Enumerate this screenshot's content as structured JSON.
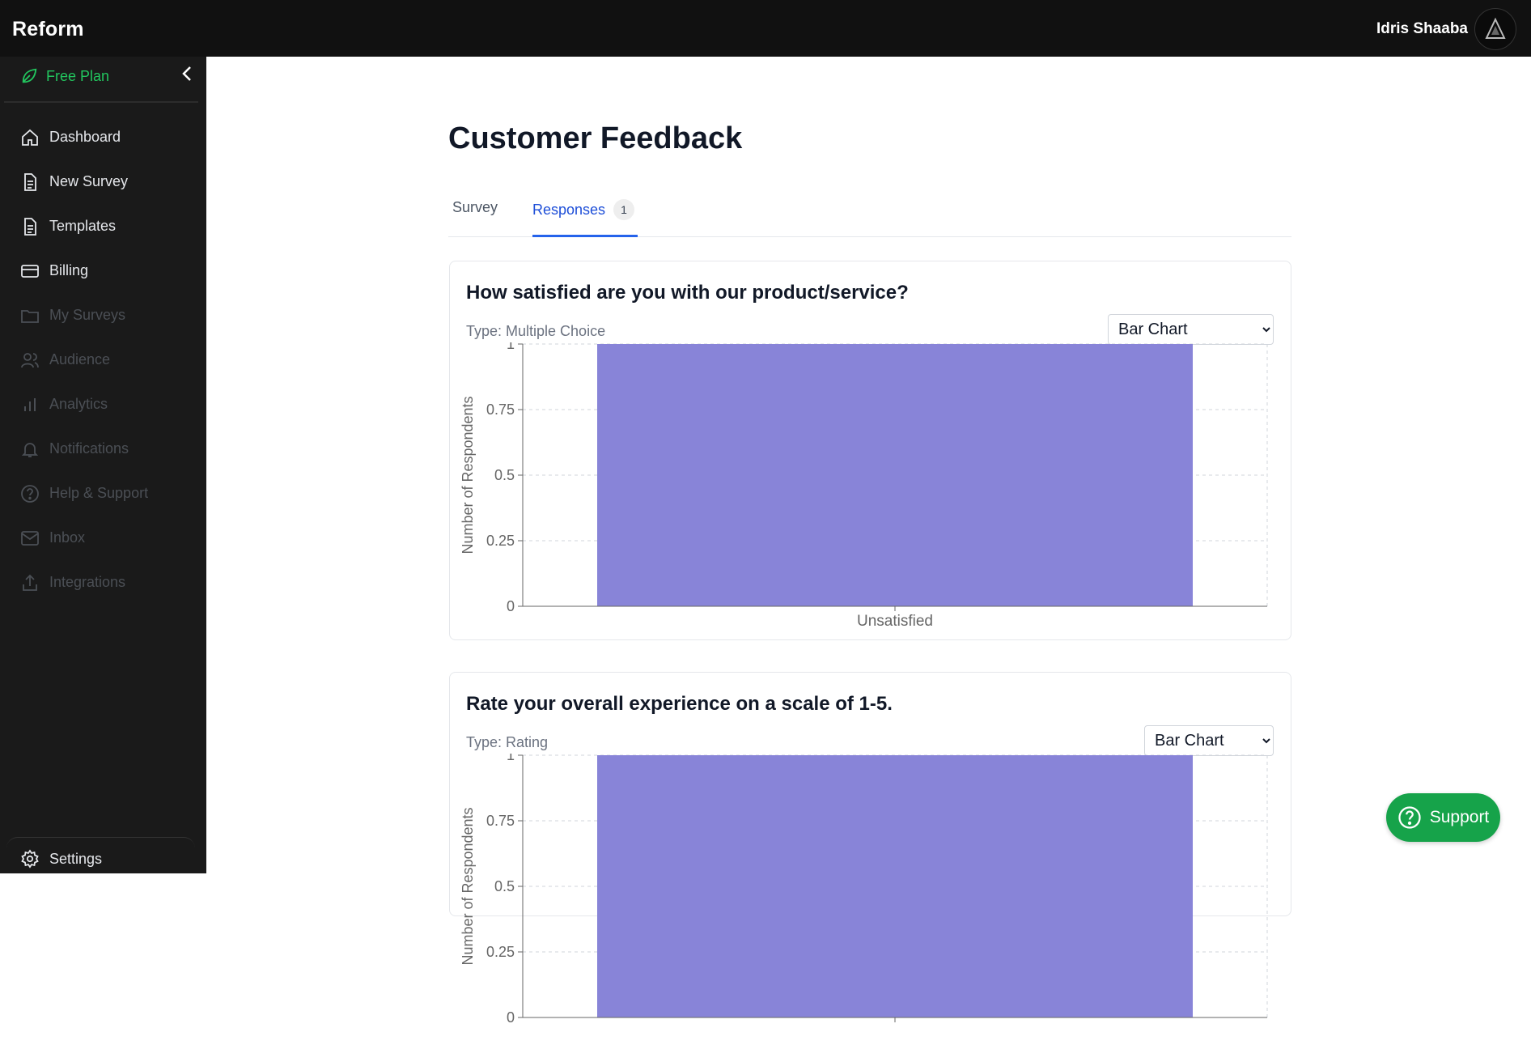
{
  "app": {
    "brand": "Reform"
  },
  "user": {
    "name": "Idris Shaaba",
    "avatar_icon": "user-avatar-icon"
  },
  "sidebar": {
    "plan_label": "Free Plan",
    "plan_color": "#22c55e",
    "items": [
      {
        "label": "Dashboard",
        "icon": "home-icon",
        "enabled": true
      },
      {
        "label": "New Survey",
        "icon": "document-icon",
        "enabled": true
      },
      {
        "label": "Templates",
        "icon": "document-icon",
        "enabled": true
      },
      {
        "label": "Billing",
        "icon": "credit-card-icon",
        "enabled": true
      },
      {
        "label": "My Surveys",
        "icon": "folder-icon",
        "enabled": false
      },
      {
        "label": "Audience",
        "icon": "users-icon",
        "enabled": false
      },
      {
        "label": "Analytics",
        "icon": "bar-chart-icon",
        "enabled": false
      },
      {
        "label": "Notifications",
        "icon": "bell-icon",
        "enabled": false
      },
      {
        "label": "Help & Support",
        "icon": "help-circle-icon",
        "enabled": false
      },
      {
        "label": "Inbox",
        "icon": "mail-icon",
        "enabled": false
      },
      {
        "label": "Integrations",
        "icon": "upload-icon",
        "enabled": false
      }
    ],
    "settings_label": "Settings"
  },
  "page": {
    "title": "Customer Feedback",
    "tabs": [
      {
        "label": "Survey",
        "active": false
      },
      {
        "label": "Responses",
        "active": true,
        "badge": "1"
      }
    ]
  },
  "questions": [
    {
      "title": "How satisfied are you with our product/service?",
      "type_label": "Type: Multiple Choice",
      "chart_select": {
        "selected": "Bar Chart",
        "options": [
          "Bar Chart"
        ]
      }
    },
    {
      "title": "Rate your overall experience on a scale of 1-5.",
      "type_label": "Type: Rating",
      "chart_select": {
        "selected": "Bar Chart",
        "options": [
          "Bar Chart"
        ]
      }
    }
  ],
  "chart_data": [
    {
      "type": "bar",
      "categories": [
        "Unsatisfied"
      ],
      "values": [
        1
      ],
      "ylabel": "Number of Respondents",
      "xlabel": "",
      "ylim": [
        0,
        1
      ],
      "yticks": [
        "0",
        "0.25",
        "0.5",
        "0.75",
        "1"
      ],
      "bar_color": "#8884d8",
      "grid": true
    },
    {
      "type": "bar",
      "categories": [],
      "values": [
        1
      ],
      "ylabel": "Number of Respondents",
      "xlabel": "",
      "ylim": [
        0,
        1
      ],
      "yticks": [
        "0",
        "0.25",
        "0.5",
        "0.75",
        "1"
      ],
      "bar_color": "#8884d8",
      "grid": true
    }
  ],
  "support": {
    "label": "Support",
    "color": "#16a34a"
  }
}
